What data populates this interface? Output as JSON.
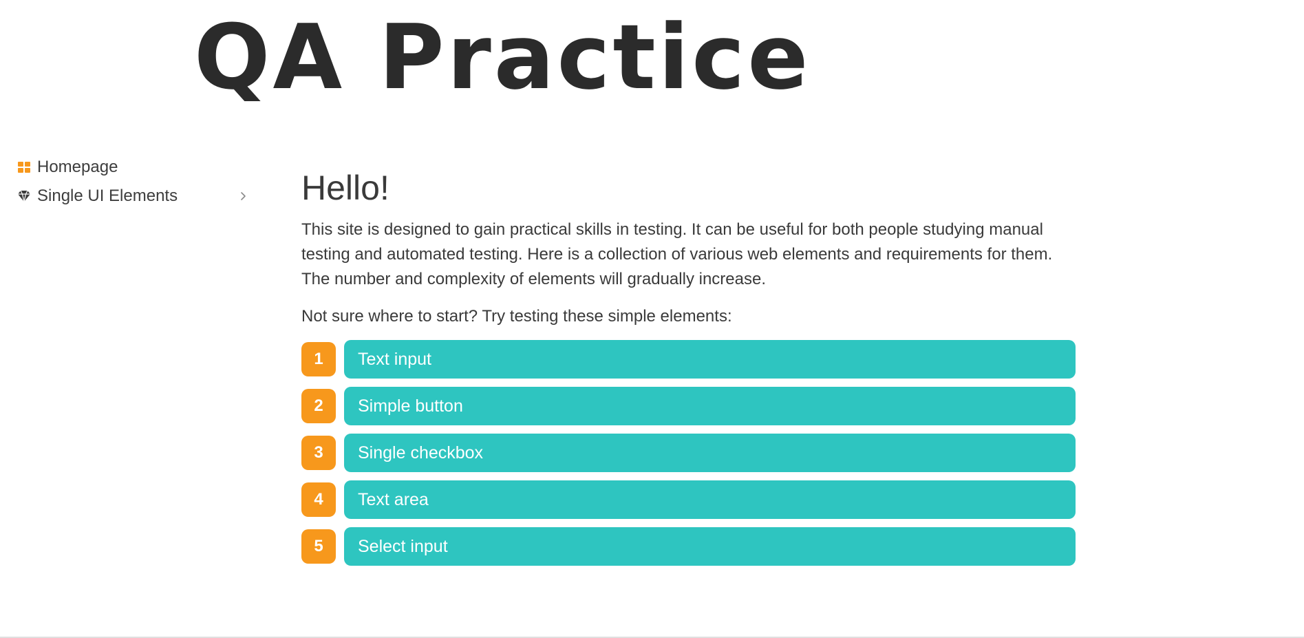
{
  "header": {
    "logo_text": "QA Practice"
  },
  "sidebar": {
    "items": [
      {
        "label": "Homepage",
        "icon": "grid-icon"
      },
      {
        "label": "Single UI Elements",
        "icon": "diamond-icon",
        "expandable": true
      }
    ]
  },
  "main": {
    "title": "Hello!",
    "intro": "This site is designed to gain practical skills in testing. It can be useful for both people studying manual testing and automated testing. Here is a collection of various web elements and requirements for them. The number and complexity of elements will gradually increase.",
    "prompt": "Not sure where to start? Try testing these simple elements:",
    "elements": [
      {
        "number": "1",
        "label": "Text input"
      },
      {
        "number": "2",
        "label": "Simple button"
      },
      {
        "number": "3",
        "label": "Single checkbox"
      },
      {
        "number": "4",
        "label": "Text area"
      },
      {
        "number": "5",
        "label": "Select input"
      }
    ]
  },
  "colors": {
    "accent_orange": "#f7981c",
    "accent_teal": "#2ec5c0",
    "text": "#3a3a3a"
  }
}
